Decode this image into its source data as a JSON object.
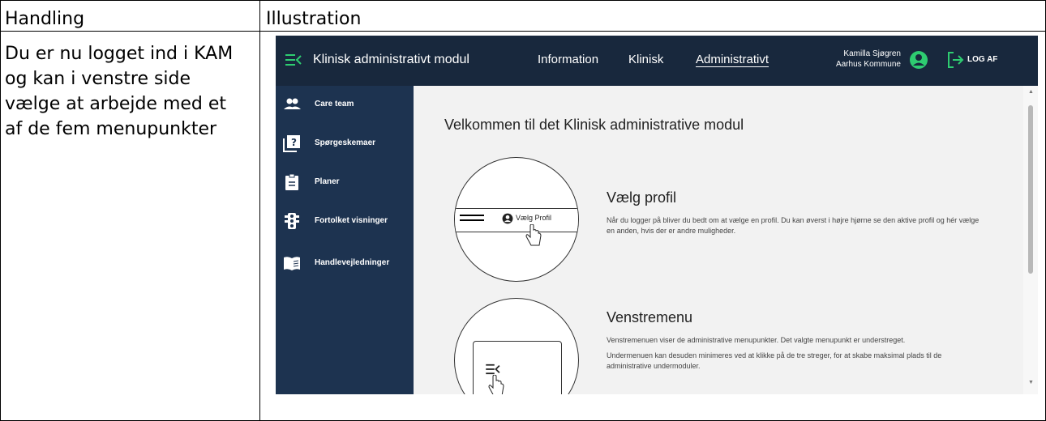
{
  "table": {
    "col1_header": "Handling",
    "col2_header": "Illustration",
    "instruction_text": "Du er nu logget ind i KAM og kan i venstre side vælge at arbejde med et af de fem menupunkter"
  },
  "app": {
    "title": "Klinisk administrativt modul",
    "nav": [
      {
        "label": "Information"
      },
      {
        "label": "Klinisk"
      },
      {
        "label": "Administrativt"
      }
    ],
    "user_name": "Kamilla Sjøgren",
    "user_org": "Aarhus Kommune",
    "logout_label": "LOG AF",
    "colors": {
      "topbar": "#18283d",
      "sidebar": "#1d3350",
      "content": "#f2f2f2"
    }
  },
  "sidebar": {
    "items": [
      {
        "label": "Care team",
        "icon": "people-icon"
      },
      {
        "label": "Spørgeskemaer",
        "icon": "questionnaire-icon"
      },
      {
        "label": "Planer",
        "icon": "clipboard-icon"
      },
      {
        "label": "Fortolket visninger",
        "icon": "traffic-light-icon"
      },
      {
        "label": "Handlevejledninger",
        "icon": "book-icon"
      }
    ]
  },
  "main": {
    "welcome": "Velkommen til det Klinisk administrative modul",
    "sections": [
      {
        "title": "Vælg profil",
        "illustration_label": "Vælg Profil",
        "paragraphs": [
          "Når du logger på bliver du bedt om at vælge en profil. Du kan øverst i højre hjørne se den aktive profil og hér vælge en anden, hvis der er andre muligheder."
        ]
      },
      {
        "title": "Venstremenu",
        "paragraphs": [
          "Venstremenuen viser de administrative menupunkter. Det valgte menupunkt er understreget.",
          "Undermenuen kan desuden minimeres ved at klikke på de tre streger, for at skabe maksimal plads til de administrative undermoduler."
        ]
      }
    ]
  }
}
